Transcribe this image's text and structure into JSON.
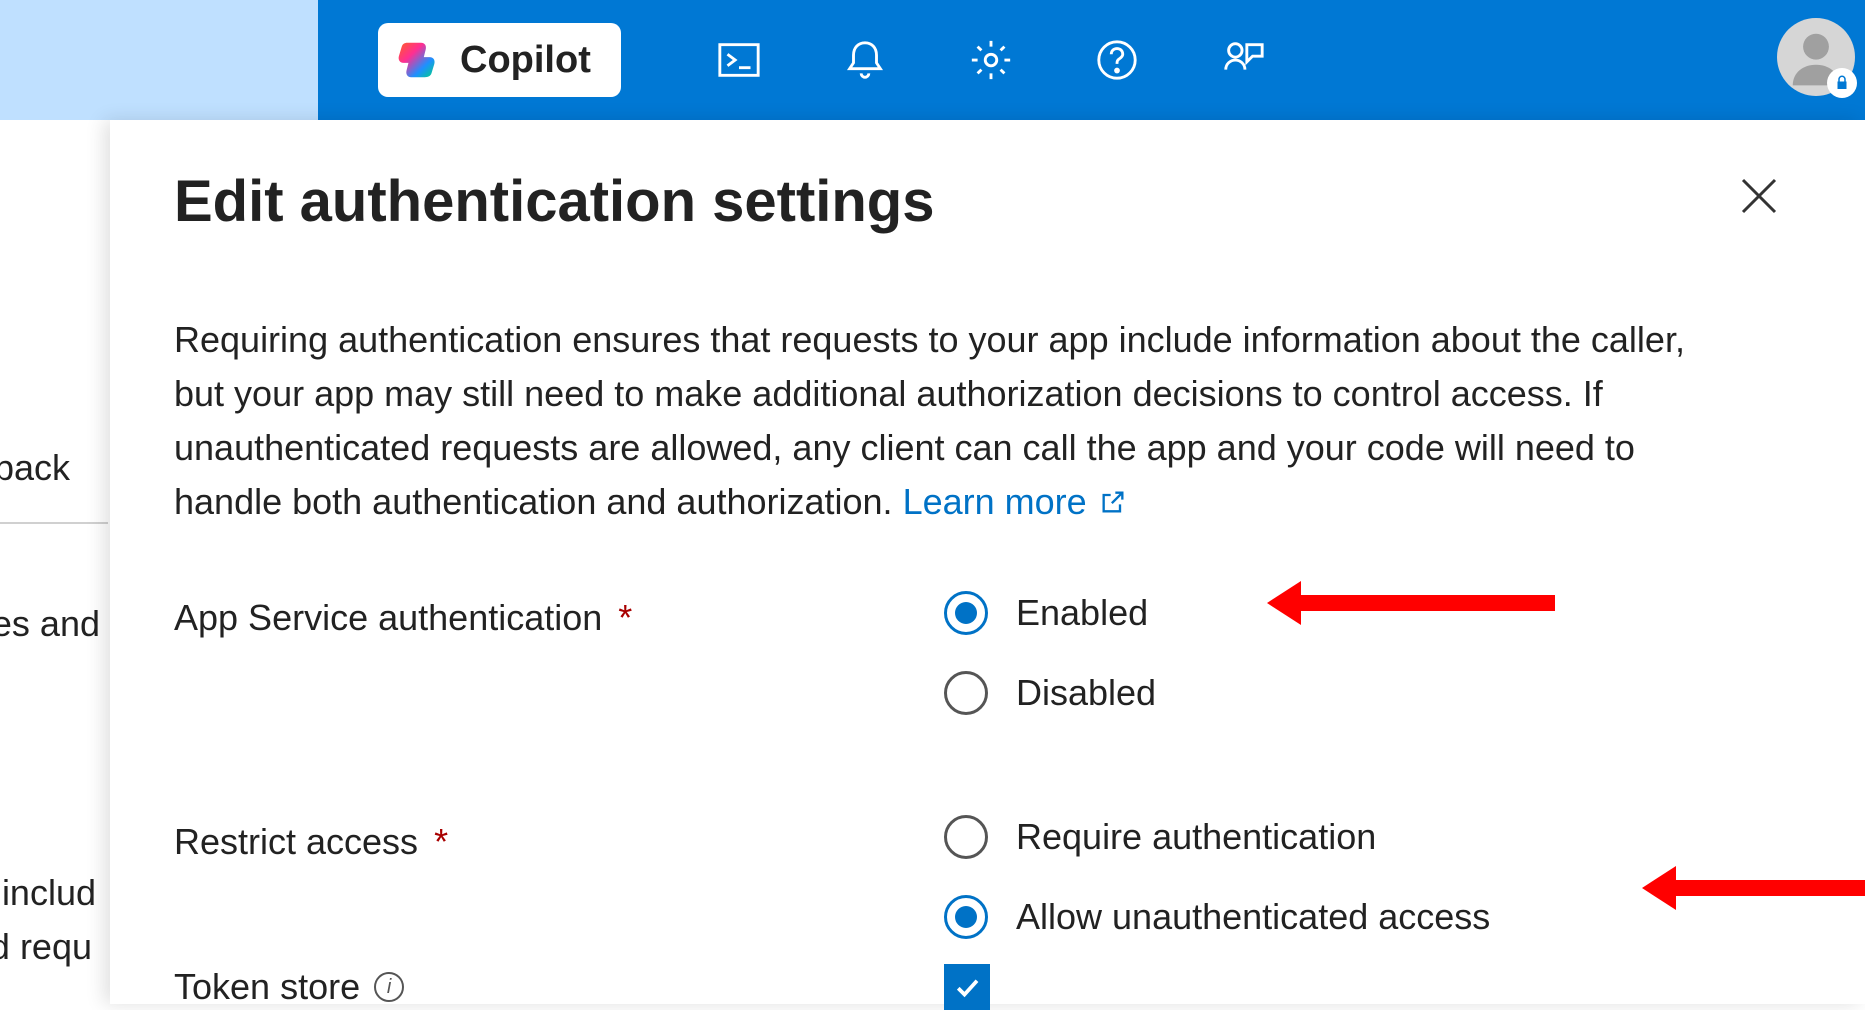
{
  "header": {
    "copilot_label": "Copilot"
  },
  "background": {
    "back_fragment": "back",
    "ties_fragment": "ties and",
    "incl_fragment": " includ",
    "req_fragment": "d requ"
  },
  "panel": {
    "title": "Edit authentication settings",
    "description_part1": "Requiring authentication ensures that requests to your app include information about the caller, but your app may still need to make additional authorization decisions to control access. If unauthenticated requests are allowed, any client can call the app and your code will need to handle both authentication and authorization. ",
    "learn_more": "Learn more",
    "fields": {
      "app_service_auth": {
        "label": "App Service authentication",
        "required": true,
        "options": [
          {
            "label": "Enabled",
            "selected": true
          },
          {
            "label": "Disabled",
            "selected": false
          }
        ]
      },
      "restrict_access": {
        "label": "Restrict access",
        "required": true,
        "options": [
          {
            "label": "Require authentication",
            "selected": false
          },
          {
            "label": "Allow unauthenticated access",
            "selected": true
          }
        ]
      },
      "token_store": {
        "label": "Token store",
        "checked": true
      }
    }
  }
}
